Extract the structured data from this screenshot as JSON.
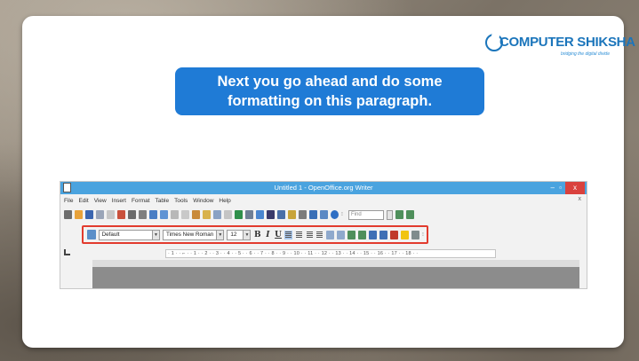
{
  "brand": {
    "name": "COMPUTER SHIKSHA",
    "tagline": "bridging the digital divide"
  },
  "heading": "Next you go ahead and do some formatting on this paragraph.",
  "window": {
    "title": "Untitled 1 - OpenOffice.org Writer",
    "minimize": "–",
    "maximize": "▫",
    "close": "x"
  },
  "menu": {
    "items": [
      "File",
      "Edit",
      "View",
      "Insert",
      "Format",
      "Table",
      "Tools",
      "Window",
      "Help"
    ],
    "close_doc": "x"
  },
  "standard_toolbar": {
    "find_placeholder": "Find"
  },
  "formatting_toolbar": {
    "paragraph_style": "Default",
    "font_name": "Times New Roman",
    "font_size": "12",
    "bold": "B",
    "italic": "I",
    "underline": "U",
    "highlight_color": "#e23b2e"
  },
  "ruler": {
    "text": "· 1 · · ⌐ · · 1 · · 2 · · 3 · · 4 · · 5 · · 6 · · 7 · · 8 · · 9 · · 10 · · 11 · · 12 · · 13 · · 14 · · 15 · · 16 · · 17 · · 18 · ·"
  },
  "colors": {
    "heading_bg": "#1f7bd6",
    "titlebar": "#4aa3df",
    "close_button": "#d9413d",
    "brand": "#1b75bb"
  }
}
